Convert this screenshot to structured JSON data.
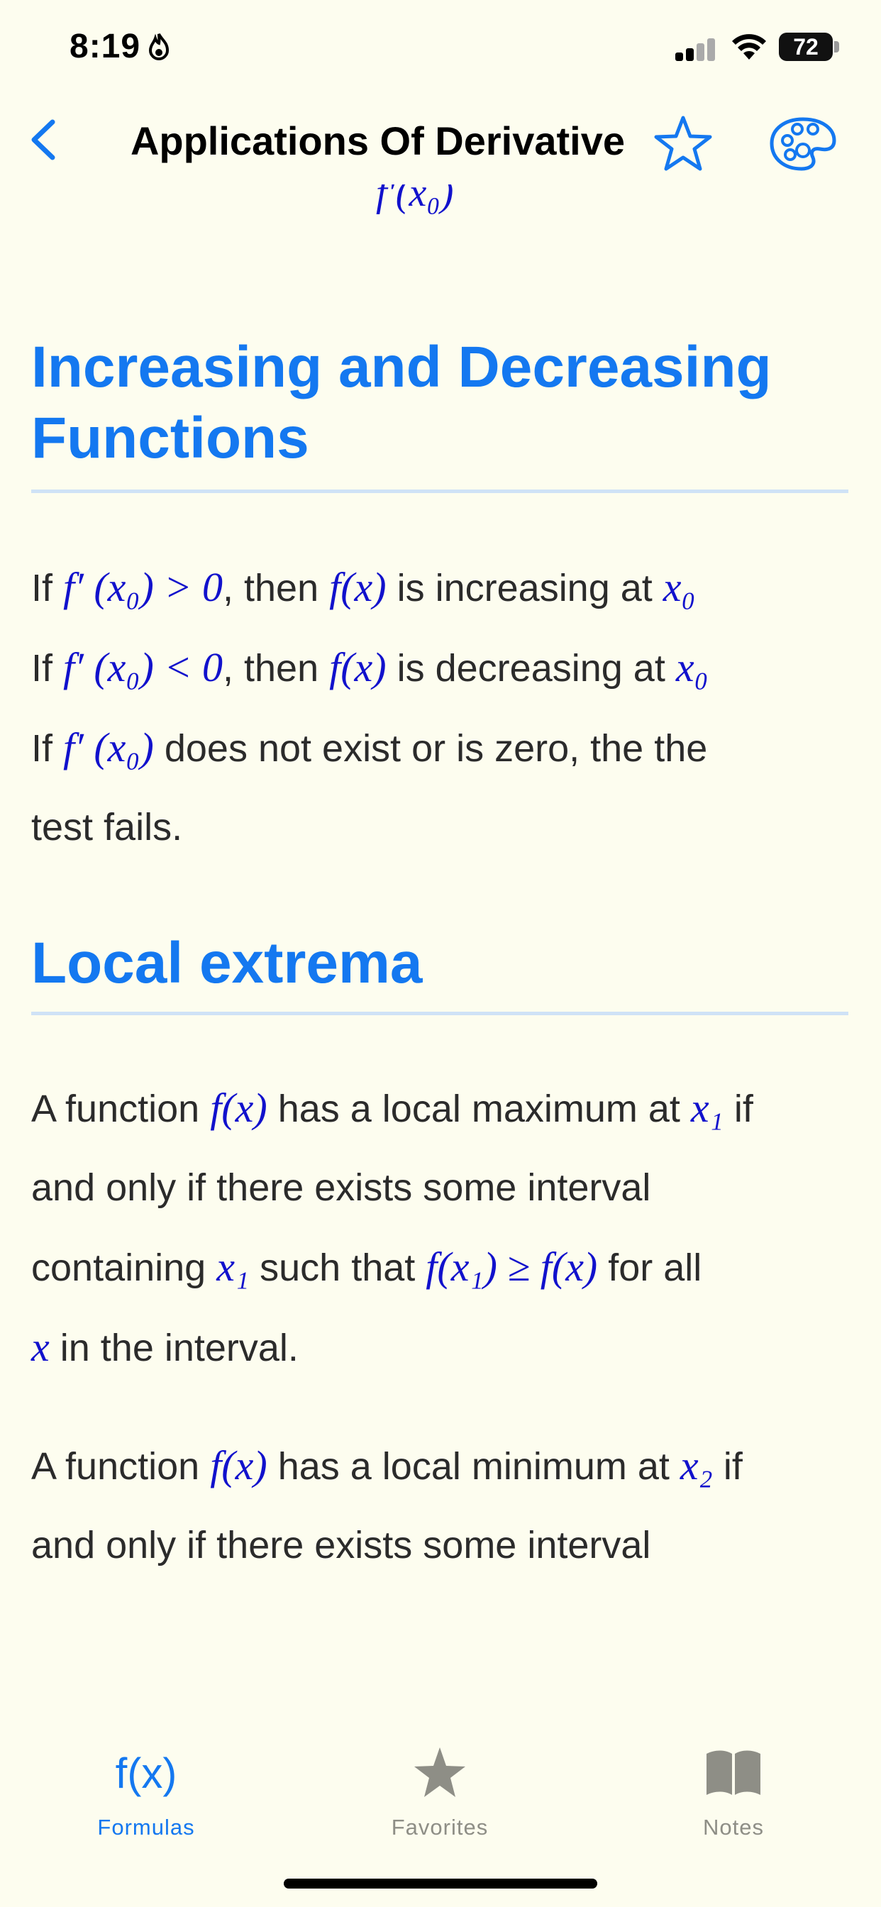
{
  "status_bar": {
    "time": "8:19",
    "battery": "72"
  },
  "nav": {
    "title": "Applications Of Derivative"
  },
  "partial_formula": "f′(x₀)",
  "sections": [
    {
      "heading_line1": "Increasing and Decreasing",
      "heading_line2": "Functions",
      "lines": [
        {
          "pre": "If ",
          "math1": "f′ (x₀) > 0",
          "mid": ", then ",
          "math2": "f(x)",
          "mid2": " is increasing at ",
          "math3": "x₀"
        },
        {
          "pre": "If ",
          "math1": "f′ (x₀) < 0",
          "mid": ", then ",
          "math2": "f(x)",
          "mid2": " is decreasing at ",
          "math3": "x₀"
        },
        {
          "pre": "If ",
          "math1": "f′ (x₀)",
          "mid": " does not exist or is zero, the the"
        },
        {
          "pre": "test fails."
        }
      ]
    },
    {
      "heading": "Local extrema",
      "para1": {
        "l1_pre": "A function ",
        "l1_math": "f(x)",
        "l1_mid": " has a local maximum at ",
        "l1_math2": "x₁",
        "l1_post": " if",
        "l2": "and only if there exists some interval",
        "l3_pre": "containing ",
        "l3_math": "x₁",
        "l3_mid": " such that ",
        "l3_math2": "f(x₁) ≥ f(x)",
        "l3_post": " for all",
        "l4_math": "x",
        "l4_post": " in the interval."
      },
      "para2": {
        "l1_pre": "A function ",
        "l1_math": "f(x)",
        "l1_mid": " has a local minimum at ",
        "l1_math2": "x₂",
        "l1_post": " if",
        "l2": "and only if there exists some interval"
      }
    }
  ],
  "tab_bar": {
    "tabs": [
      {
        "label": "Formulas",
        "icon": "function-icon",
        "active": true
      },
      {
        "label": "Favorites",
        "icon": "star-icon",
        "active": false
      },
      {
        "label": "Notes",
        "icon": "book-icon",
        "active": false
      }
    ],
    "fx_text": "f(x)"
  },
  "colors": {
    "accent": "#1478f0",
    "math": "#1111cc",
    "background": "#fdfdef",
    "inactive": "#8e8e86",
    "rule": "#cfe2f6"
  }
}
